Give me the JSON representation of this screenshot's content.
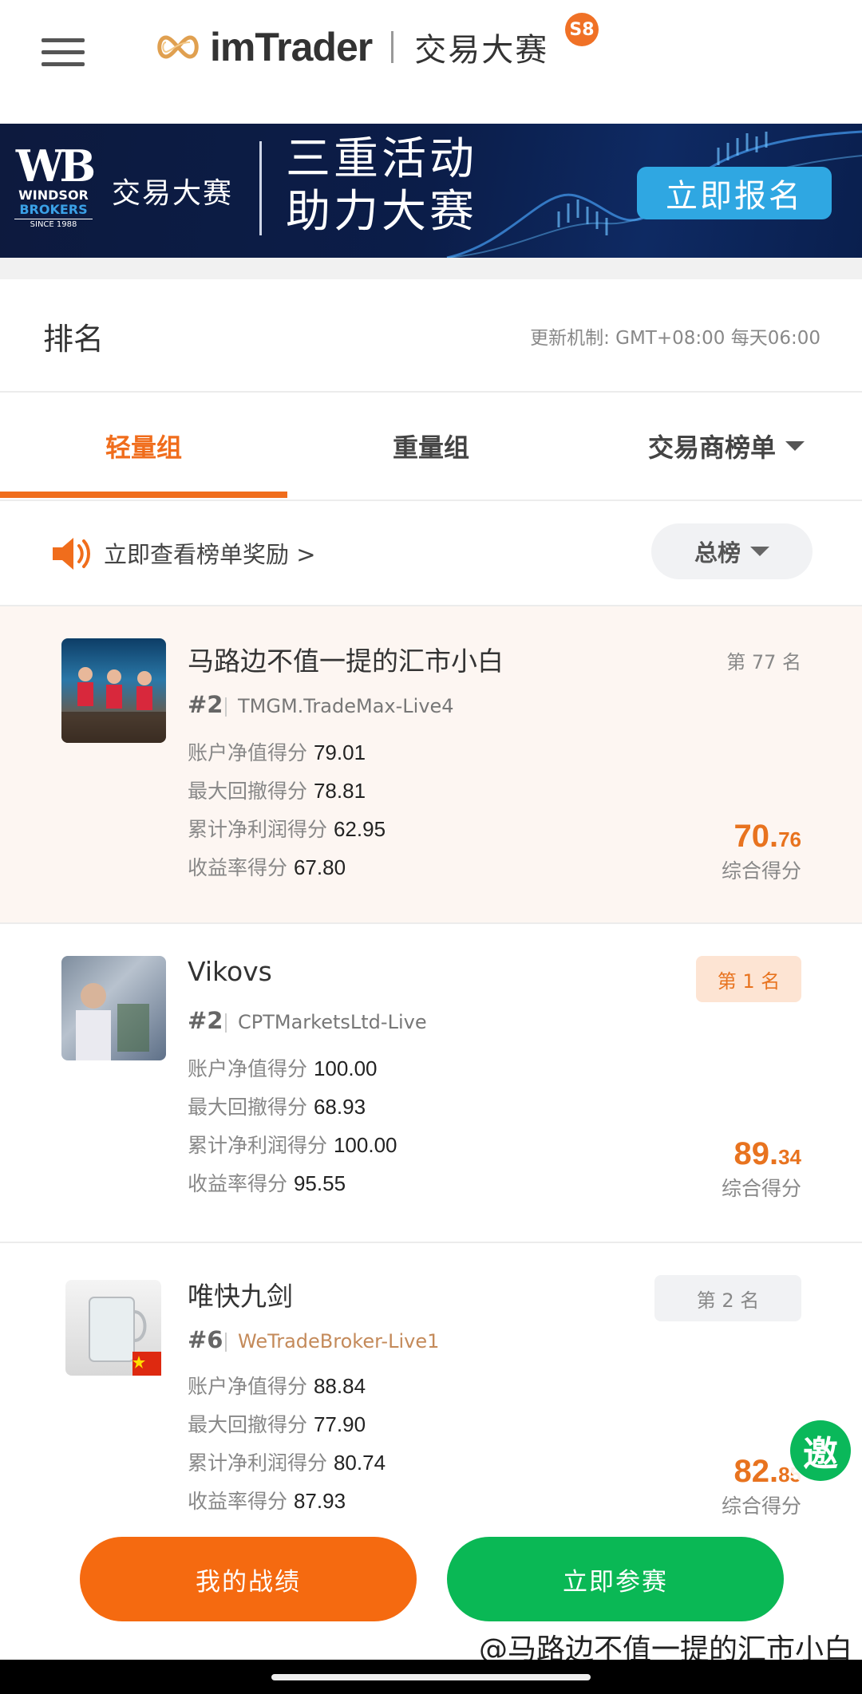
{
  "header": {
    "logo_text": "imTrader",
    "logo_sub": "交易大赛",
    "season_badge": "S8"
  },
  "banner": {
    "broker_mark": "WB",
    "broker_line1": "WINDSOR",
    "broker_line2": "BROKERS",
    "broker_since": "SINCE 1988",
    "subtitle": "交易大赛",
    "headline_1": "三重活动",
    "headline_2": "助力大赛",
    "cta": "立即报名"
  },
  "ranking": {
    "title": "排名",
    "update_note": "更新机制: GMT+08:00 每天06:00"
  },
  "tabs": [
    {
      "label": "轻量组",
      "active": true
    },
    {
      "label": "重量组",
      "active": false
    },
    {
      "label": "交易商榜单",
      "active": false
    }
  ],
  "notice": {
    "text": "立即查看榜单奖励 >",
    "filter": "总榜"
  },
  "stat_labels": {
    "equity": "账户净值得分",
    "drawdown": "最大回撤得分",
    "profit": "累计净利润得分",
    "return": "收益率得分",
    "composite": "综合得分"
  },
  "cards": [
    {
      "name": "马路边不值一提的汇市小白",
      "rank_no": "#2",
      "broker": "TMGM.TradeMax-Live4",
      "place": "第 77 名",
      "equity": "79.01",
      "drawdown": "78.81",
      "profit": "62.95",
      "return": "67.80",
      "score_int": "70.",
      "score_dec": "76"
    },
    {
      "name": "Vikovs",
      "rank_no": "#2",
      "broker": "CPTMarketsLtd-Live",
      "place": "第 1 名",
      "equity": "100.00",
      "drawdown": "68.93",
      "profit": "100.00",
      "return": "95.55",
      "score_int": "89.",
      "score_dec": "34"
    },
    {
      "name": "唯快九剑",
      "rank_no": "#6",
      "broker": "WeTradeBroker-Live1",
      "place": "第 2 名",
      "equity": "88.84",
      "drawdown": "77.90",
      "profit": "80.74",
      "return": "87.93",
      "score_int": "82.",
      "score_dec": "85"
    }
  ],
  "invite_label": "邀",
  "buttons": {
    "my_record": "我的战绩",
    "join_now": "立即参赛"
  },
  "watermark": "@马路边不值一提的汇市小白",
  "colors": {
    "accent": "#f06d1c",
    "green": "#0ab855",
    "banner_bg": "#0b1d49"
  }
}
